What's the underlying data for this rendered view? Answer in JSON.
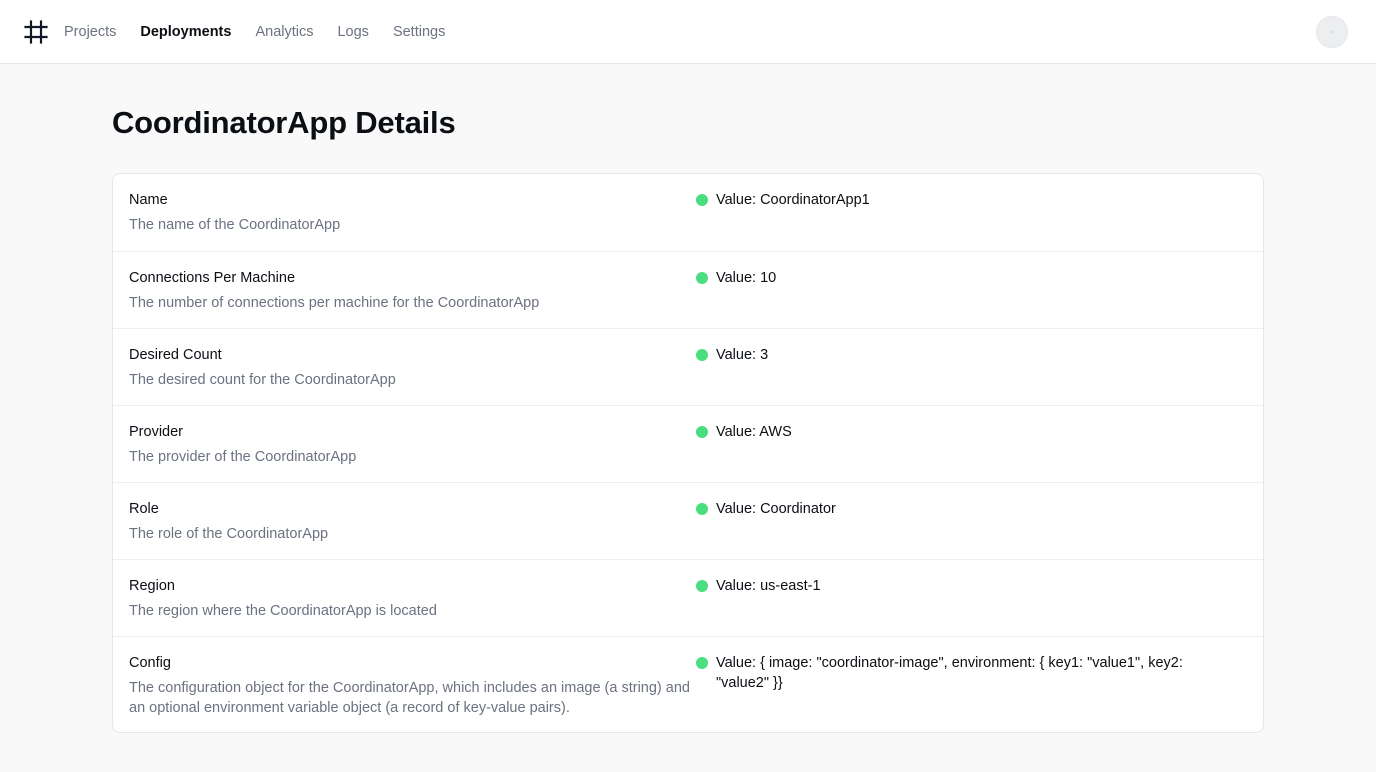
{
  "nav": {
    "logo_icon": "hash-grid-icon",
    "items": [
      {
        "label": "Projects",
        "active": false
      },
      {
        "label": "Deployments",
        "active": true
      },
      {
        "label": "Analytics",
        "active": false
      },
      {
        "label": "Logs",
        "active": false
      },
      {
        "label": "Settings",
        "active": false
      }
    ]
  },
  "page": {
    "title": "CoordinatorApp Details"
  },
  "details": [
    {
      "label": "Name",
      "description": "The name of the CoordinatorApp",
      "value": "Value: CoordinatorApp1"
    },
    {
      "label": "Connections Per Machine",
      "description": "The number of connections per machine for the CoordinatorApp",
      "value": "Value: 10"
    },
    {
      "label": "Desired Count",
      "description": "The desired count for the CoordinatorApp",
      "value": "Value: 3"
    },
    {
      "label": "Provider",
      "description": "The provider of the CoordinatorApp",
      "value": "Value: AWS"
    },
    {
      "label": "Role",
      "description": "The role of the CoordinatorApp",
      "value": "Value: Coordinator"
    },
    {
      "label": "Region",
      "description": "The region where the CoordinatorApp is located",
      "value": "Value: us-east-1"
    },
    {
      "label": "Config",
      "description": "The configuration object for the CoordinatorApp, which includes an image (a string) and an optional environment variable object (a record of key-value pairs).",
      "value": "Value: { image: \"coordinator-image\", environment: { key1: \"value1\", key2: \"value2\" }}"
    }
  ],
  "colors": {
    "status_dot": "#4ade80",
    "background": "#f8f9f8",
    "muted_text": "#6b7280"
  }
}
